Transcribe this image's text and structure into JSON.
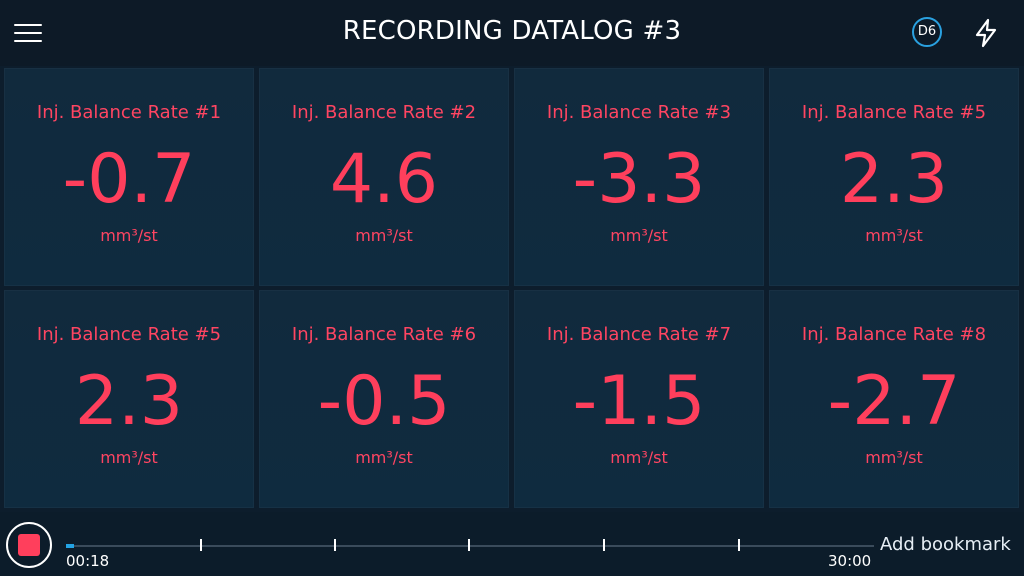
{
  "header": {
    "title": "RECORDING DATALOG #3",
    "menu_icon": "hamburger-menu-icon",
    "badge_label": "D6",
    "bolt_icon": "lightning-bolt-icon"
  },
  "cards": [
    {
      "label": "Inj. Balance Rate #1",
      "value": "-0.7",
      "unit": "mm³/st"
    },
    {
      "label": "Inj. Balance Rate #2",
      "value": "4.6",
      "unit": "mm³/st"
    },
    {
      "label": "Inj. Balance Rate #3",
      "value": "-3.3",
      "unit": "mm³/st"
    },
    {
      "label": "Inj. Balance Rate #5",
      "value": "2.3",
      "unit": "mm³/st"
    },
    {
      "label": "Inj. Balance Rate #5",
      "value": "2.3",
      "unit": "mm³/st"
    },
    {
      "label": "Inj. Balance Rate #6",
      "value": "-0.5",
      "unit": "mm³/st"
    },
    {
      "label": "Inj. Balance Rate #7",
      "value": "-1.5",
      "unit": "mm³/st"
    },
    {
      "label": "Inj. Balance Rate #8",
      "value": "-2.7",
      "unit": "mm³/st"
    }
  ],
  "footer": {
    "record_icon": "stop-record-icon",
    "elapsed": "00:18",
    "total": "30:00",
    "progress_fraction": 0.01,
    "bookmark_label": "Add bookmark"
  },
  "colors": {
    "accent_red": "#ff3f5c",
    "accent_blue": "#23a3e4",
    "background": "#0d1d2c"
  }
}
